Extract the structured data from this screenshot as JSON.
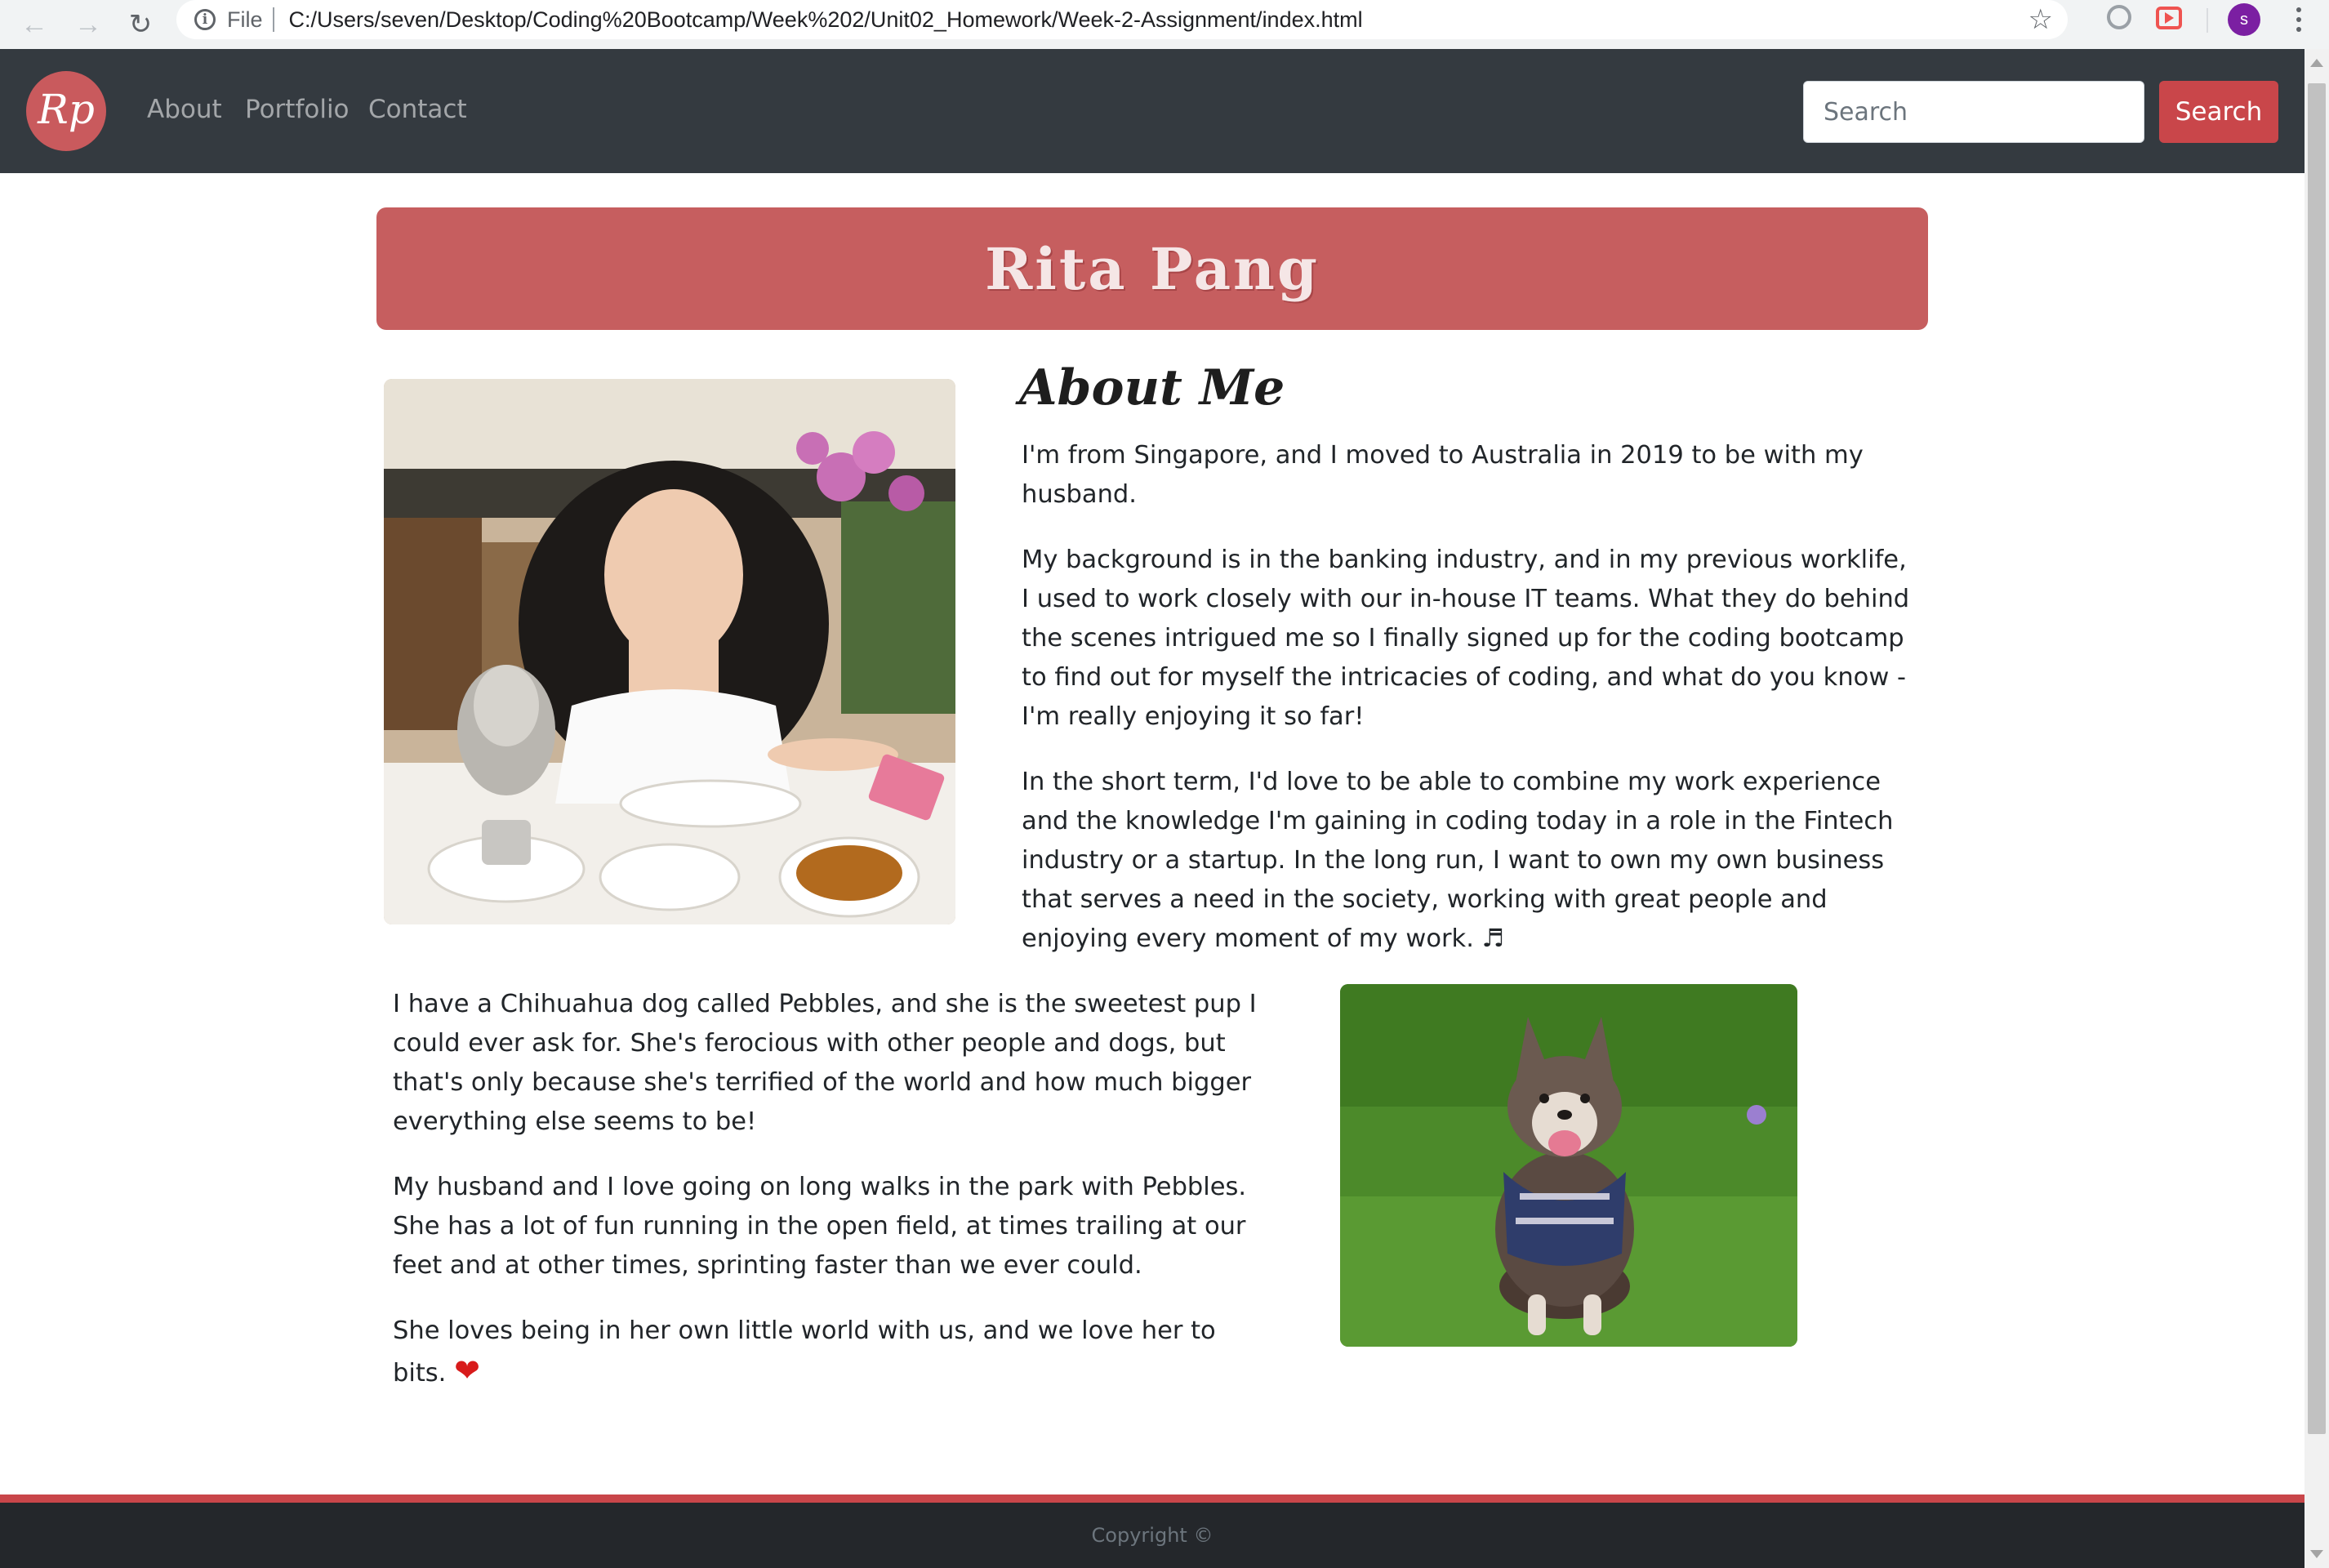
{
  "browser": {
    "file_label": "File",
    "url": "C:/Users/seven/Desktop/Coding%20Bootcamp/Week%202/Unit02_Homework/Week-2-Assignment/index.html",
    "profile_initial": "s"
  },
  "navbar": {
    "logo_text": "Rp",
    "links": [
      "About",
      "Portfolio",
      "Contact"
    ],
    "search_placeholder": "Search",
    "search_button": "Search"
  },
  "banner": {
    "title": "Rita Pang"
  },
  "about": {
    "title": "About Me",
    "paragraphs": [
      "I'm from Singapore, and I moved to Australia in 2019 to be with my husband.",
      "My background is in the banking industry, and in my previous worklife, I used to work closely with our in-house IT teams. What they do behind the scenes intrigued me so I finally signed up for the coding bootcamp to find out for myself the intricacies of coding, and what do you know - I'm really enjoying it so far!",
      "In the short term, I'd love to be able to combine my work experience and the knowledge I'm gaining in coding today in a role in the Fintech industry or a startup. In the long run, I want to own my own business that serves a need in the society, working with great people and enjoying every moment of my work. ♬"
    ]
  },
  "pebbles": {
    "paragraphs": [
      "I have a Chihuahua dog called Pebbles, and she is the sweetest pup I could ever ask for. She's ferocious with other people and dogs, but that's only because she's terrified of the world and how much bigger everything else seems to be!",
      "My husband and I love going on long walks in the park with Pebbles. She has a lot of fun running in the open field, at times trailing at our feet and at other times, sprinting faster than we ever could.",
      "She loves being in her own little world with us, and we love her to bits."
    ],
    "heart_glyph": "❤"
  },
  "footer": {
    "text": "Copyright ©"
  },
  "colors": {
    "navbar": "#343a40",
    "accent": "#c9464a",
    "banner": "#c65e5f",
    "footer": "#24272b"
  }
}
